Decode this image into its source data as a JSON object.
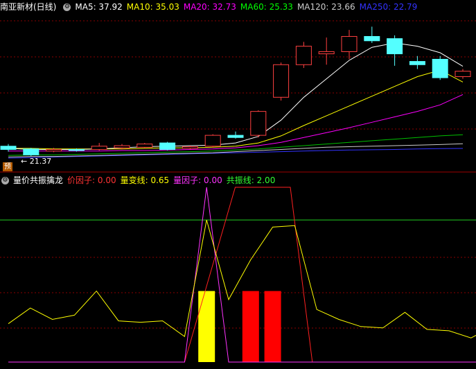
{
  "header": {
    "title": "南亚新材(日线)",
    "ma": [
      {
        "label": "MA5: 37.92",
        "color": "#ffffff"
      },
      {
        "label": "MA10: 35.03",
        "color": "#ffff00"
      },
      {
        "label": "MA20: 32.73",
        "color": "#ff00ff"
      },
      {
        "label": "MA60: 25.33",
        "color": "#00ff00"
      },
      {
        "label": "MA120: 23.66",
        "color": "#cccccc"
      },
      {
        "label": "MA250: 22.79",
        "color": "#3333ff"
      }
    ]
  },
  "low_label": "← 21.37",
  "badge": "预",
  "indicator": {
    "title": "量价共振擒龙",
    "items": [
      {
        "label": "价因子: 0.00",
        "color": "#ff3333"
      },
      {
        "label": "量变线: 0.65",
        "color": "#ffff00"
      },
      {
        "label": "量因子: 0.00",
        "color": "#ff33ff"
      },
      {
        "label": "共振线: 2.00",
        "color": "#33ff33"
      }
    ]
  },
  "colors": {
    "up": "#ff4040",
    "down": "#54ffff",
    "grid": "#8b0000"
  },
  "chart_data": {
    "type": "candlestick",
    "candles": [
      {
        "o": 23.2,
        "c": 22.6,
        "h": 23.6,
        "l": 22.2
      },
      {
        "o": 22.7,
        "c": 21.6,
        "h": 22.9,
        "l": 21.4
      },
      {
        "o": 22.3,
        "c": 22.6,
        "h": 22.9,
        "l": 22.1
      },
      {
        "o": 22.6,
        "c": 22.4,
        "h": 22.8,
        "l": 22.2
      },
      {
        "o": 22.6,
        "c": 23.2,
        "h": 23.8,
        "l": 22.4
      },
      {
        "o": 22.9,
        "c": 23.3,
        "h": 23.6,
        "l": 22.6
      },
      {
        "o": 23.0,
        "c": 23.6,
        "h": 23.8,
        "l": 22.8
      },
      {
        "o": 23.8,
        "c": 22.6,
        "h": 24.0,
        "l": 22.4
      },
      {
        "o": 22.8,
        "c": 23.1,
        "h": 23.3,
        "l": 22.6
      },
      {
        "o": 23.2,
        "c": 25.2,
        "h": 25.4,
        "l": 22.9
      },
      {
        "o": 25.2,
        "c": 24.8,
        "h": 25.9,
        "l": 24.6
      },
      {
        "o": 25.2,
        "c": 29.6,
        "h": 29.8,
        "l": 24.8
      },
      {
        "o": 32.2,
        "c": 38.2,
        "h": 38.6,
        "l": 31.6
      },
      {
        "o": 38.2,
        "c": 41.6,
        "h": 42.4,
        "l": 37.6
      },
      {
        "o": 40.2,
        "c": 40.6,
        "h": 43.2,
        "l": 38.2
      },
      {
        "o": 40.6,
        "c": 43.4,
        "h": 44.6,
        "l": 39.2
      },
      {
        "o": 43.4,
        "c": 42.6,
        "h": 45.2,
        "l": 42.2
      },
      {
        "o": 43.0,
        "c": 40.2,
        "h": 43.6,
        "l": 38.0
      },
      {
        "o": 38.8,
        "c": 38.2,
        "h": 39.8,
        "l": 37.4
      },
      {
        "o": 39.2,
        "c": 35.8,
        "h": 39.8,
        "l": 35.4
      },
      {
        "o": 36.0,
        "c": 37.0,
        "h": 37.4,
        "l": 35.6
      }
    ],
    "ma5": [
      22.8,
      22.6,
      22.6,
      22.6,
      22.7,
      22.9,
      23.1,
      23.2,
      23.3,
      23.4,
      23.8,
      25.0,
      28.0,
      32.2,
      35.6,
      39.0,
      41.4,
      42.2,
      41.6,
      40.4,
      37.9
    ],
    "ma10": [
      22.8,
      22.8,
      22.7,
      22.7,
      22.7,
      22.7,
      22.8,
      22.9,
      22.9,
      23.0,
      23.2,
      23.8,
      25.1,
      27.0,
      28.8,
      30.6,
      32.4,
      34.2,
      36.0,
      37.2,
      35.0
    ],
    "ma20": [
      22.3,
      22.3,
      22.3,
      22.3,
      22.3,
      22.4,
      22.4,
      22.5,
      22.6,
      22.7,
      22.9,
      23.3,
      23.9,
      24.8,
      25.7,
      26.6,
      27.6,
      28.6,
      29.6,
      30.8,
      32.7
    ],
    "ma60": [
      21.5,
      21.6,
      21.6,
      21.7,
      21.8,
      21.9,
      22.0,
      22.1,
      22.2,
      22.3,
      22.5,
      22.7,
      23.0,
      23.3,
      23.6,
      23.9,
      24.2,
      24.5,
      24.8,
      25.1,
      25.3
    ],
    "ma120": [
      21.2,
      21.3,
      21.3,
      21.4,
      21.5,
      21.6,
      21.7,
      21.8,
      21.9,
      22.0,
      22.2,
      22.4,
      22.6,
      22.8,
      23.0,
      23.1,
      23.2,
      23.3,
      23.4,
      23.5,
      23.66
    ],
    "ma250": [
      21.0,
      21.1,
      21.2,
      21.3,
      21.4,
      21.5,
      21.6,
      21.7,
      21.8,
      21.9,
      22.0,
      22.1,
      22.2,
      22.3,
      22.4,
      22.5,
      22.55,
      22.6,
      22.7,
      22.75,
      22.79
    ],
    "ind_yellow": [
      0.27,
      0.38,
      0.3,
      0.33,
      0.5,
      0.29,
      0.28,
      0.29,
      0.18,
      1.0,
      0.44,
      0.72,
      0.95,
      0.96,
      0.37,
      0.3,
      0.25,
      0.24,
      0.35,
      0.23,
      0.22,
      0.17,
      0.25
    ],
    "ind_magenta": [
      0,
      0,
      0,
      0,
      0,
      0,
      0,
      0,
      0,
      1.23,
      0,
      0,
      0,
      0,
      0,
      0,
      0,
      0,
      0,
      0,
      0,
      0,
      0
    ],
    "ind_red": [
      0,
      0,
      0,
      0,
      0,
      0,
      0,
      0,
      0,
      0,
      0,
      1.23,
      1.23,
      0,
      0,
      0,
      0,
      0,
      0,
      0,
      0,
      0,
      0
    ],
    "ind_bars": [
      {
        "i": 9,
        "v": 0.5,
        "color": "#ffff00"
      },
      {
        "i": 11,
        "v": 0.5,
        "color": "#ff0000"
      },
      {
        "i": 12,
        "v": 0.5,
        "color": "#ff0000"
      }
    ],
    "resonance_line": 1.0
  }
}
